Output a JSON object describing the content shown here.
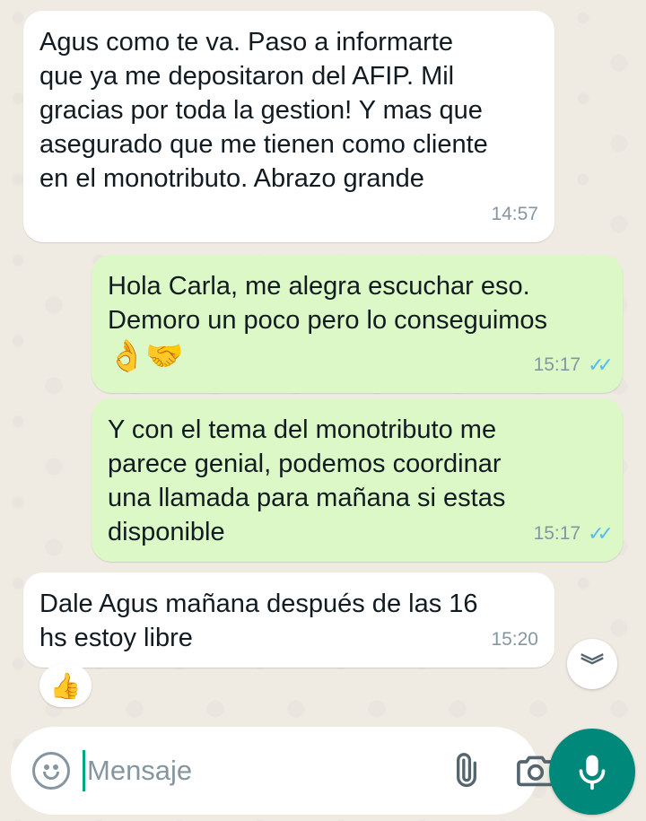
{
  "messages": [
    {
      "direction": "incoming",
      "text": "Agus como te va. Paso a informarte\nque ya me depositaron del AFIP. Mil\ngracias por toda la gestion! Y mas que\nasegurado que me tienen como cliente\nen el monotributo. Abrazo grande",
      "time": "14:57"
    },
    {
      "direction": "outgoing",
      "text": "Hola Carla, me alegra escuchar eso.\nDemoro un poco pero lo conseguimos",
      "emojis": "👌🤝",
      "time": "15:17",
      "status": "read"
    },
    {
      "direction": "outgoing",
      "text": "Y con el tema del monotributo me\nparece genial, podemos coordinar\nuna llamada para mañana si estas\ndisponible",
      "time": "15:17",
      "status": "read"
    },
    {
      "direction": "incoming",
      "text": "Dale Agus mañana después de las 16\nhs estoy libre",
      "time": "15:20"
    }
  ],
  "reaction": {
    "emoji": "👍"
  },
  "scroll_down": {
    "icon": "double-chevron-down-icon",
    "glyph": "︾"
  },
  "composer": {
    "placeholder": "Mensaje",
    "value": ""
  },
  "icons": {
    "emoji": "smiley-icon",
    "attach": "paperclip-icon",
    "camera": "camera-icon",
    "mic": "microphone-icon"
  },
  "colors": {
    "incoming_bubble": "#FFFFFF",
    "outgoing_bubble": "#DCF8C6",
    "read_ticks": "#53BDEB",
    "accent": "#00897B",
    "background": "#EFEAE2"
  }
}
